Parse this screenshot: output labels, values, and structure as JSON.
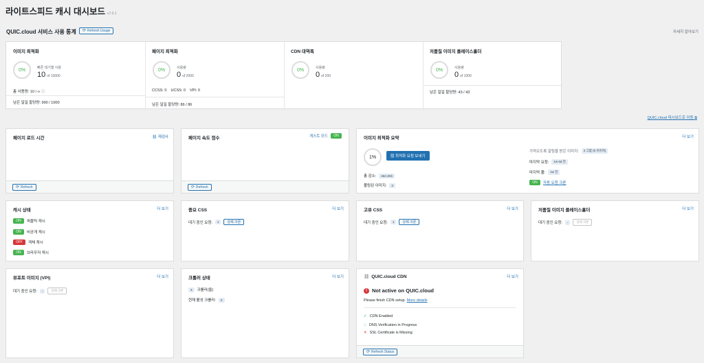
{
  "header": {
    "title": "라이트스피드 캐시 대시보드",
    "version": "v7.0.1"
  },
  "usage": {
    "title": "QUIC.cloud 서비스 사용 통계",
    "refresh_label": "Refresh Usage",
    "more_link": "자세히 알아보기",
    "dashboard_link": "QUIC.cloud 대시보드로 이동",
    "cards": [
      {
        "title": "이미지 최적화",
        "percent": "0%",
        "label": "빠른 대기열 사용",
        "value": "10",
        "of": "of 10000",
        "line1": "총 사용량: 10 / ∞",
        "line2": "남은 일일 할당량: 990 / 1000"
      },
      {
        "title": "페이지 최적화",
        "percent": "0%",
        "label": "사용량",
        "value": "0",
        "of": "of 2000",
        "line1": "CCSS: 0    UCSS: 0    VPI: 0",
        "line2": "남은 일일 할당량: 86 / 86"
      },
      {
        "title": "CDN 대역폭",
        "percent": "0%",
        "label": "사용량",
        "value": "0",
        "of": "of 200"
      },
      {
        "title": "저품질 이미지 플레이스홀더",
        "percent": "0%",
        "label": "사용량",
        "value": "0",
        "of": "of 1000",
        "line1": "남은 일일 할당량: 43 / 43"
      }
    ]
  },
  "pageload": {
    "title": "페이지 로드 시간",
    "link": "재검사",
    "refresh": "Refresh"
  },
  "pagespeed": {
    "title": "페이지 속도 점수",
    "guest": "게스트 모드",
    "on": "ON",
    "refresh": "Refresh"
  },
  "imgopt": {
    "title": "이미지 최적화 요약",
    "more": "더 보기",
    "percent": "1%",
    "send": "최적화 요청 보내기",
    "reduced_label": "총 감소:",
    "reduced_val": "462.3Kb",
    "pulled_label": "풀링된 이미지:",
    "pulled_val": "3",
    "notified_label": "가져오도록 알림을 받은 이미지:",
    "notified_val": "2 그룹 (9 이미지)",
    "last_req_label": "마지막 요청:",
    "last_req_val": "1w 6d 전",
    "last_pull_label": "마지막 풀:",
    "last_pull_val": "1w 전",
    "auto_on": "ON",
    "auto_label": "자동 요청 크론"
  },
  "cache": {
    "title": "캐시 상태",
    "more": "더 보기",
    "items": [
      {
        "state": "ON",
        "label": "퍼블릭 캐시"
      },
      {
        "state": "ON",
        "label": "비공개 캐시"
      },
      {
        "state": "OFF",
        "label": "객체 캐시"
      },
      {
        "state": "ON",
        "label": "브라우저 캐시"
      }
    ]
  },
  "ccss": {
    "title": "중요 CSS",
    "more": "더 보기",
    "queue_label": "대기 중인 요청:",
    "queue_val": "1",
    "cron": "강제 크론"
  },
  "ucss": {
    "title": "고유 CSS",
    "more": "더 보기",
    "queue_label": "대기 중인 요청:",
    "queue_val": "1",
    "cron": "강제 크론"
  },
  "lqip": {
    "title": "저품질 이미지 플레이스홀더",
    "more": "더 보기",
    "queue_label": "대기 중인 요청:",
    "queue_val": "-",
    "cron": "강제 크론"
  },
  "vpi": {
    "title": "뷰포트 이미지 (VPI)",
    "more": "더 보기",
    "queue_label": "대기 중인 요청:",
    "queue_val": "-",
    "cron": "강제 크론"
  },
  "crawler": {
    "title": "크롤러 상태",
    "more": "더 보기",
    "count": "3",
    "count_label": "크롤러(들)",
    "active_label": "현재 활성 크롤러:",
    "active_val": "0"
  },
  "cdn": {
    "title": "QUIC.cloud CDN",
    "more": "더 보기",
    "status": "Not active on QUIC.cloud",
    "finish": "Please finish CDN setup.",
    "details": "More details",
    "checks": [
      {
        "icon": "check",
        "label": "CDN Enabled"
      },
      {
        "icon": "progress",
        "label": "DNS Verification in Progress"
      },
      {
        "icon": "cross",
        "label": "SSL Certificate is Missing"
      }
    ],
    "refresh": "Refresh Status"
  }
}
